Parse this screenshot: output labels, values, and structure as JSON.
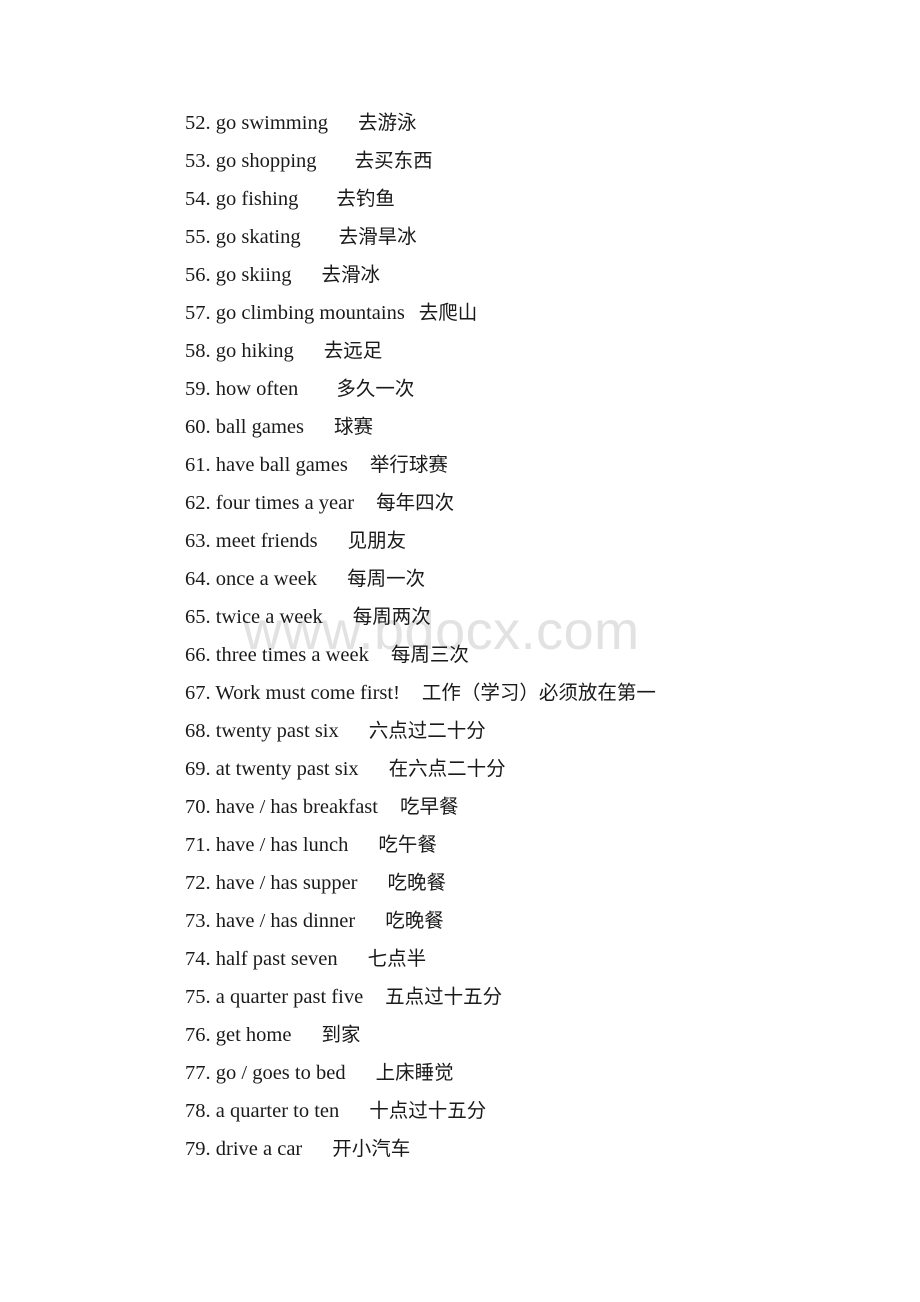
{
  "document": {
    "type": "vocabulary-phrase-list",
    "language_pair": "English-Chinese",
    "watermark": "www.bdocx.com",
    "background_color": "#ffffff",
    "text_color": "#1a1a1a",
    "watermark_color": "#e2e2e2"
  },
  "entries": [
    {
      "num": "52.",
      "en": "go swimming",
      "zh": "去游泳",
      "gap": 3
    },
    {
      "num": "53.",
      "en": "go shopping",
      "zh": "去买东西",
      "gap": 4
    },
    {
      "num": "54.",
      "en": "go fishing",
      "zh": "去钓鱼",
      "gap": 4
    },
    {
      "num": "55.",
      "en": "go skating",
      "zh": "去滑旱冰",
      "gap": 4
    },
    {
      "num": "56.",
      "en": "go skiing",
      "zh": "去滑冰",
      "gap": 3
    },
    {
      "num": "57.",
      "en": "go climbing mountains",
      "zh": "去爬山",
      "gap": 1
    },
    {
      "num": "58.",
      "en": "go hiking",
      "zh": "去远足",
      "gap": 3
    },
    {
      "num": "59.",
      "en": "how often",
      "zh": "多久一次",
      "gap": 4
    },
    {
      "num": "60.",
      "en": "ball games",
      "zh": "球赛",
      "gap": 3
    },
    {
      "num": "61.",
      "en": "have ball games",
      "zh": "举行球赛",
      "gap": 2
    },
    {
      "num": "62.",
      "en": "four times a year",
      "zh": "每年四次",
      "gap": 2
    },
    {
      "num": "63.",
      "en": "meet friends",
      "zh": "见朋友",
      "gap": 3
    },
    {
      "num": "64.",
      "en": "once a week",
      "zh": "每周一次",
      "gap": 3
    },
    {
      "num": "65.",
      "en": "twice a week",
      "zh": "每周两次",
      "gap": 3
    },
    {
      "num": "66.",
      "en": "three times a week",
      "zh": "每周三次",
      "gap": 2
    },
    {
      "num": "67.",
      "en": "Work must come first!",
      "zh": "工作（学习）必须放在第一",
      "gap": 2
    },
    {
      "num": "68.",
      "en": "twenty past six",
      "zh": "六点过二十分",
      "gap": 3
    },
    {
      "num": "69.",
      "en": "at twenty past six",
      "zh": "在六点二十分",
      "gap": 3
    },
    {
      "num": "70.",
      "en": "have / has breakfast",
      "zh": "吃早餐",
      "gap": 2
    },
    {
      "num": "71.",
      "en": "have / has lunch",
      "zh": "吃午餐",
      "gap": 3
    },
    {
      "num": "72.",
      "en": "have / has supper",
      "zh": "吃晚餐",
      "gap": 3
    },
    {
      "num": "73.",
      "en": "have / has dinner",
      "zh": "吃晚餐",
      "gap": 3
    },
    {
      "num": "74.",
      "en": "half past seven",
      "zh": "七点半",
      "gap": 3
    },
    {
      "num": "75.",
      "en": "a quarter past five",
      "zh": "五点过十五分",
      "gap": 2
    },
    {
      "num": "76.",
      "en": "get home",
      "zh": "到家",
      "gap": 3
    },
    {
      "num": "77.",
      "en": "go / goes to bed",
      "zh": "上床睡觉",
      "gap": 3
    },
    {
      "num": "78.",
      "en": "a quarter to ten",
      "zh": "十点过十五分",
      "gap": 3
    },
    {
      "num": "79.",
      "en": "drive a car",
      "zh": "开小汽车",
      "gap": 3
    }
  ]
}
